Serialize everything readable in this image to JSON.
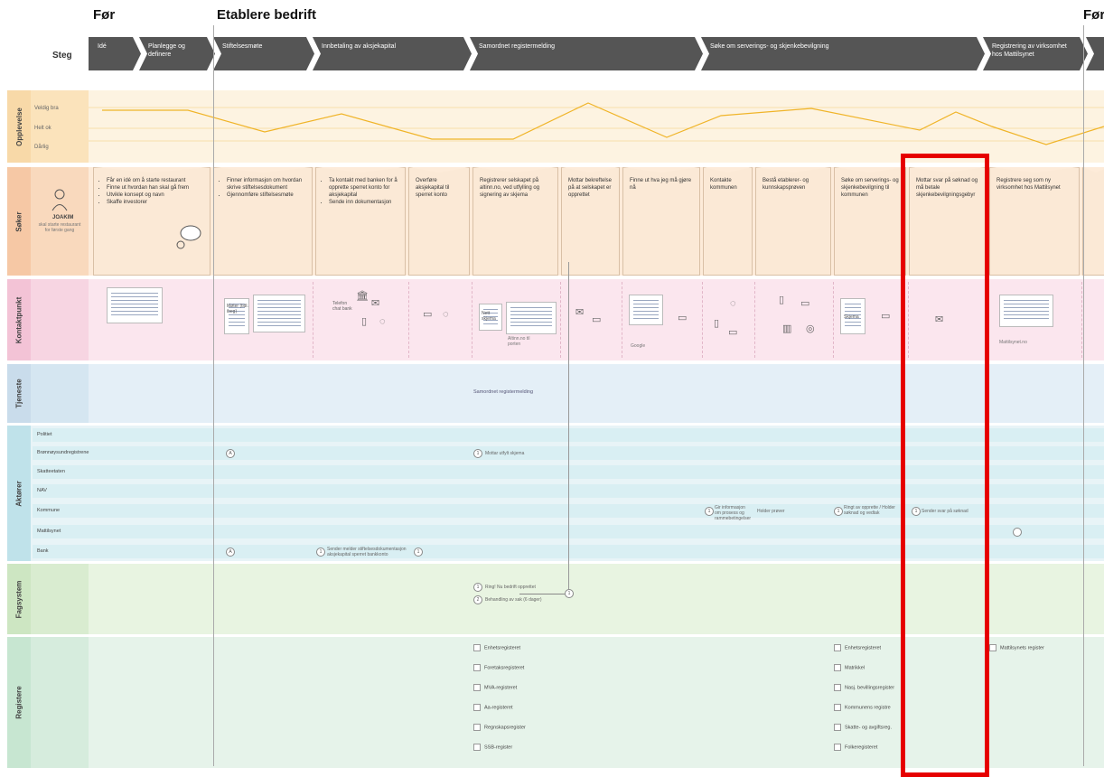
{
  "phases": [
    "Før",
    "Etablere bedrift",
    "Før"
  ],
  "steg_label": "Steg",
  "steps": [
    "Idé",
    "Planlegge og definere",
    "Stiftelsesmøte",
    "Innbetaling av aksjekapital",
    "Samordnet registermelding",
    "Søke om serverings- og skjenkebevilgning",
    "Registrering av virksomhet hos Mattilsynet"
  ],
  "lanes": {
    "opplevelse": "Opplevelse",
    "soker": "Søker",
    "kontaktpunkt": "Kontaktpunkt",
    "tjeneste": "Tjeneste",
    "aktorer": "Aktører",
    "fagsystem": "Fagsystem",
    "registere": "Registere"
  },
  "ratings": [
    "Veldig bra",
    "Helt ok",
    "Dårlig"
  ],
  "persona": {
    "name": "JOAKIM",
    "desc": "skal starte restaurant for første gang"
  },
  "cards": [
    {
      "items": [
        "Får en idé om å starte restaurant",
        "Finne ut hvordan han skal gå frem",
        "Utvikle konsept og navn",
        "Skaffe investorer"
      ]
    },
    {
      "items": [
        "Finner informasjon om hvordan skrive stiftelsesdokument",
        "Gjennomføre stiftelsesmøte"
      ]
    },
    {
      "items": [
        "Ta kontakt med banken for å opprette sperret konto for aksjekapital",
        "Sende inn dokumentasjon"
      ]
    },
    {
      "text": "Overføre aksjekapital til sperret konto"
    },
    {
      "text": "Registrerer selskapet på altinn.no, ved utfylling og signering av skjema"
    },
    {
      "text": "Mottar bekreftelse på at selskapet er opprettet"
    },
    {
      "text": "Finne ut hva jeg må gjøre nå"
    },
    {
      "text": "Kontakte kommunen"
    },
    {
      "text": "Bestå etablerer- og kunnskapsprøven"
    },
    {
      "text": "Søke om serverings- og skjenkebevilgning til kommunen"
    },
    {
      "text": "Mottar svar på søknad og må betale skjenkebevilgningsgebyr"
    },
    {
      "text": "Registrere seg som ny virksomhet hos Mattilsynet"
    }
  ],
  "touch_labels": {
    "mater": "Møter (tidl. ibeg)",
    "telefon": "Telefon chat bank",
    "nett": "Nett skjema",
    "altinn": "Altinn.no til porten",
    "google": "Google",
    "skjema": "Skjema",
    "mattilsynet": "Mattilsynet.no"
  },
  "tjeneste_note": "Samordnet registermelding",
  "actors": [
    "Politiet",
    "Brønnøysundregistrene",
    "Skatteetaten",
    "NAV",
    "Kommune",
    "Mattilsynet",
    "Bank"
  ],
  "actor_notes": {
    "bronnoy": "Mottar utfylt skjema",
    "bank": "Sender melder stiftelsesdokumentasjon aksjekapital sperret bankkonto",
    "kommune1": "Gir informasjon om prosess og rammebetingelser",
    "kommune2": "Holder prøver",
    "kommune3": "Ringt av opprette / Holder søknad og vedtak",
    "kommune4": "Sender svar på søknad"
  },
  "fagsystem_notes": [
    "Ring! Nu bedrift opprettet",
    "Behandling av sak (6 dager)"
  ],
  "registers_left": [
    "Enhetsregisteret",
    "Foretaksregisteret",
    "MVA-registeret",
    "Aa-registeret",
    "Regnskapsregister",
    "SSB-register"
  ],
  "registers_right": [
    "Enhetsregisteret",
    "Matrikkel",
    "Nasj. bevillingsregister",
    "Kommunens registre",
    "Skatte- og avgiftsreg.",
    "Folkeregisteret"
  ],
  "registers_mattilsynet": "Mattilsynets register",
  "colors": {
    "step": "#555555",
    "opplevelse": "#fdf3e1",
    "soker": "#fdebd9",
    "kontakt": "#fbe6ee",
    "tjeneste": "#e4eff7",
    "aktorer": "#e8f4f7",
    "fagsystem": "#e8f4e1",
    "registere": "#e6f3ea",
    "experience_line": "#f0b428",
    "highlight": "#e60000"
  }
}
